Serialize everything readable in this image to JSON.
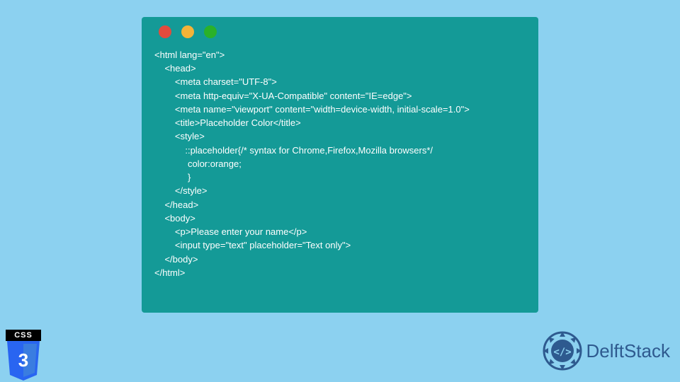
{
  "code": {
    "lines": [
      "<html lang=\"en\">",
      "    <head>",
      "        <meta charset=\"UTF-8\">",
      "        <meta http-equiv=\"X-UA-Compatible\" content=\"IE=edge\">",
      "        <meta name=\"viewport\" content=\"width=device-width, initial-scale=1.0\">",
      "        <title>Placeholder Color</title>",
      "        <style>",
      "            ::placeholder{/* syntax for Chrome,Firefox,Mozilla browsers*/",
      "             color:orange;",
      "             }",
      "        </style>",
      "    </head>",
      "    <body>",
      "        <p>Please enter your name</p>",
      "        <input type=\"text\" placeholder=\"Text only\">",
      "    </body>",
      "</html>"
    ]
  },
  "logos": {
    "css3_label": "CSS",
    "css3_number": "3",
    "delftstack_text": "DelftStack"
  },
  "colors": {
    "page_bg": "#8cd1f0",
    "window_bg": "#149a97",
    "dot_red": "#e24b3d",
    "dot_yellow": "#f4b338",
    "dot_green": "#2ab12a",
    "code_text": "#ffffff",
    "css3_blue": "#2465f1",
    "delft_blue": "#2e5a8f"
  }
}
